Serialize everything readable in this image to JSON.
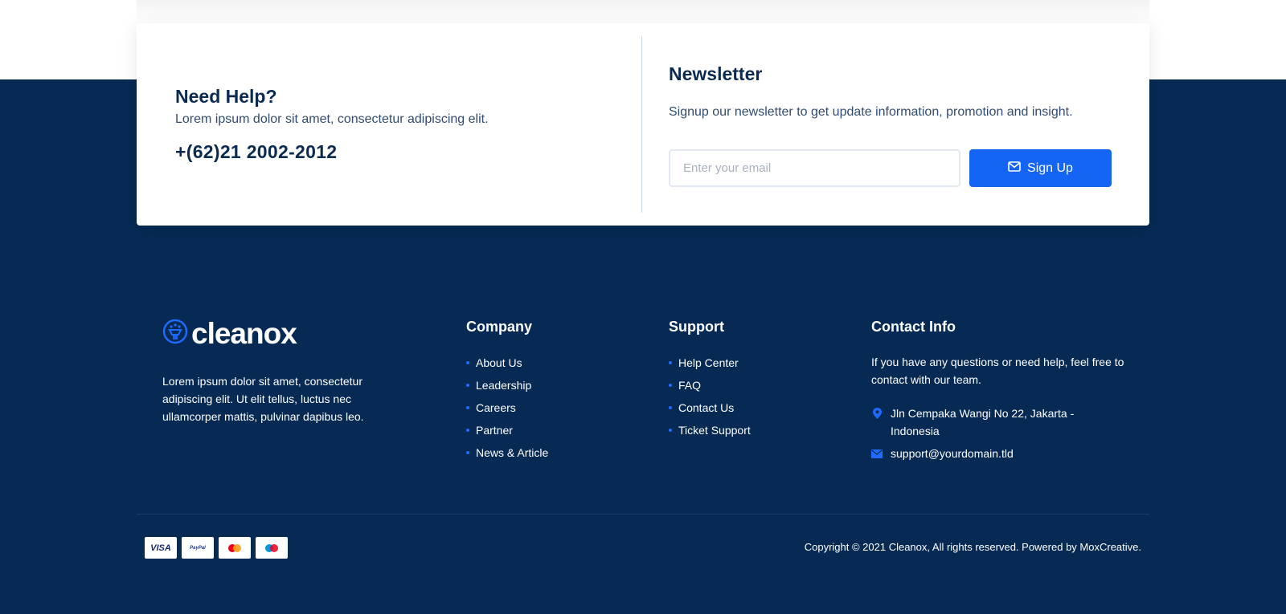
{
  "help": {
    "title": "Need Help?",
    "text": "Lorem ipsum dolor sit amet, consectetur adipiscing elit.",
    "phone": "+(62)21 2002-2012"
  },
  "newsletter": {
    "title": "Newsletter",
    "text": "Signup our newsletter to get update information, promotion and insight.",
    "email_placeholder": "Enter your email",
    "button_label": "Sign Up"
  },
  "brand": {
    "name": "cleanox",
    "description": "Lorem ipsum dolor sit amet, consectetur adipiscing elit. Ut elit tellus, luctus nec ullamcorper mattis, pulvinar dapibus leo."
  },
  "company": {
    "title": "Company",
    "links": [
      "About Us",
      "Leadership",
      "Careers",
      "Partner",
      "News & Article"
    ]
  },
  "support": {
    "title": "Support",
    "links": [
      "Help Center",
      "FAQ",
      "Contact Us",
      "Ticket Support"
    ]
  },
  "contact": {
    "title": "Contact Info",
    "text": "If you have any questions or need help, feel free to contact with our team.",
    "address": "Jln Cempaka Wangi No 22, Jakarta - Indonesia",
    "email": "support@yourdomain.tld"
  },
  "payments": {
    "visa": "VISA",
    "paypal": "PayPal"
  },
  "footer": {
    "copyright": "Copyright © 2021 Cleanox, All rights reserved. Powered by MoxCreative."
  },
  "colors": {
    "footer_bg": "#062a54",
    "accent": "#1565f5",
    "heading": "#0b2a4f"
  },
  "icons": {
    "brand": "cleaning-logo-icon",
    "newsletter_button": "envelope-icon",
    "address": "map-pin-icon",
    "email": "envelope-icon"
  }
}
